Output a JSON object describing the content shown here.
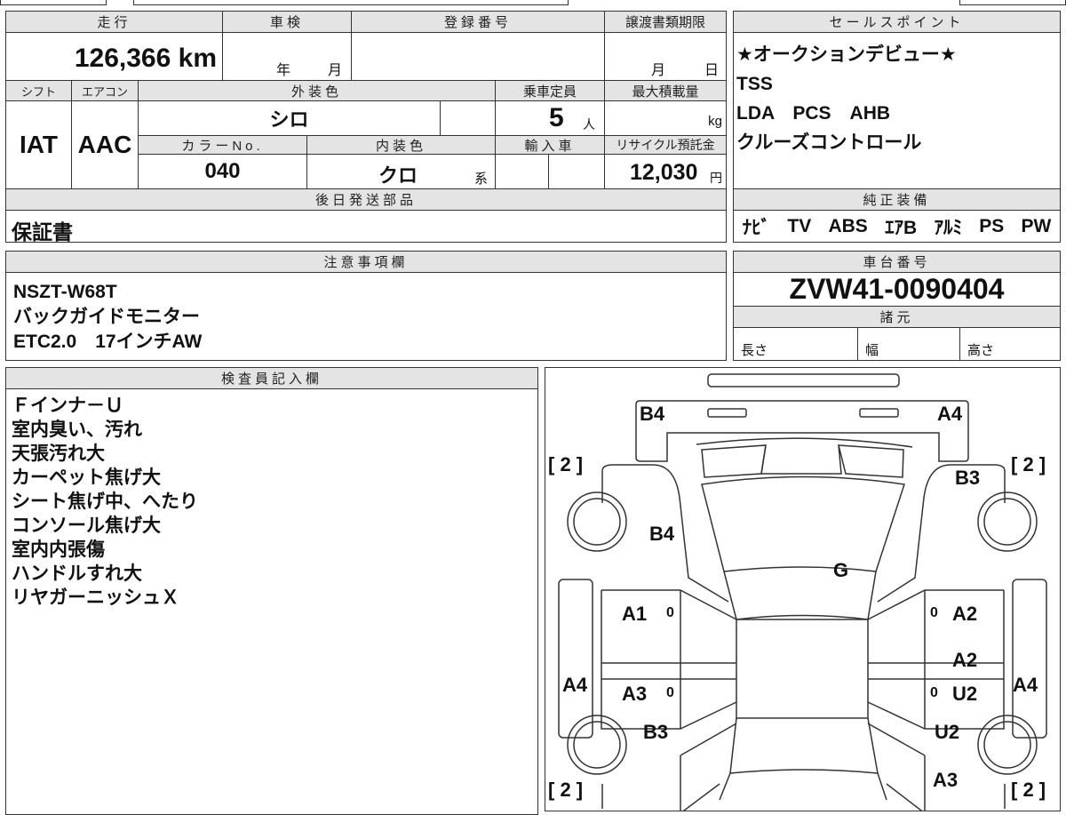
{
  "mileage": {
    "label": "走行",
    "value": "126,366",
    "unit": "km"
  },
  "shaken": {
    "label": "車検",
    "year": "年",
    "month": "月"
  },
  "registration": {
    "label": "登録番号",
    "value": ""
  },
  "transfer_deadline": {
    "label": "譲渡書類期限",
    "month": "月",
    "day": "日"
  },
  "shift": {
    "label": "シフト",
    "value": "IAT"
  },
  "aircon": {
    "label": "エアコン",
    "value": "AAC"
  },
  "exterior_color": {
    "label": "外装色",
    "value": "シロ"
  },
  "capacity": {
    "label": "乗車定員",
    "value": "5",
    "unit": "人"
  },
  "max_load": {
    "label": "最大積載量",
    "unit": "kg"
  },
  "color_no": {
    "label": "カラーNo.",
    "value": "040"
  },
  "interior_color": {
    "label": "内装色",
    "value": "クロ",
    "suffix": "系"
  },
  "import": {
    "label": "輸入車"
  },
  "recycle": {
    "label": "リサイクル預託金",
    "value": "12,030",
    "unit": "円"
  },
  "later_parts": {
    "label": "後日発送部品",
    "value": "保証書"
  },
  "sales_points": {
    "label": "セールスポイント",
    "lines": [
      "★オークションデビュー★",
      "TSS",
      "LDA　PCS　AHB",
      "クルーズコントロール"
    ]
  },
  "equipment": {
    "label": "純正装備",
    "items": [
      "ﾅﾋﾞ",
      "TV",
      "ABS",
      "ｴｱB",
      "ｱﾙﾐ",
      "PS",
      "PW"
    ]
  },
  "notes": {
    "label": "注意事項欄",
    "lines": [
      "NSZT-W68T",
      "バックガイドモニター",
      "ETC2.0　17インチAW"
    ]
  },
  "chassis": {
    "label": "車台番号",
    "value": "ZVW41-0090404"
  },
  "specs": {
    "label": "諸元",
    "length": "長さ",
    "width": "幅",
    "height": "高さ"
  },
  "inspector": {
    "label": "検査員記入欄",
    "lines": [
      "Ｆインナ－Ｕ",
      "室内臭い、汚れ",
      "天張汚れ大",
      "カーペット焦げ大",
      "シート焦げ中、へたり",
      "コンソール焦げ大",
      "室内内張傷",
      "ハンドルすれ大",
      "リヤガーニッシュＸ"
    ]
  },
  "diagram": {
    "labels": [
      "B4",
      "A4",
      "[ 2 ]",
      "[ 2 ]",
      "B3",
      "B4",
      "G",
      "A1",
      "0",
      "0",
      "A2",
      "A2",
      "A4",
      "A3",
      "0",
      "0",
      "U2",
      "A4",
      "B3",
      "U2",
      "A3",
      "[ 2 ]",
      "[ 2 ]"
    ]
  }
}
